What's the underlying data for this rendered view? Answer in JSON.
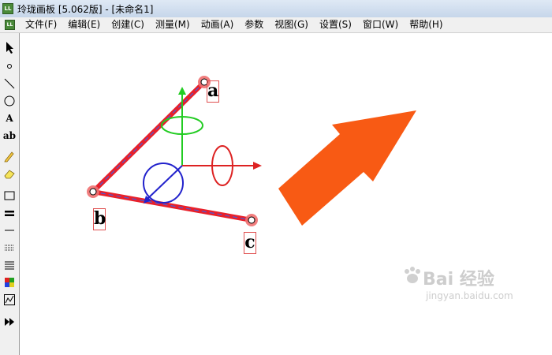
{
  "window": {
    "title": "玲珑画板 [5.062版] - [未命名1]"
  },
  "menu": {
    "items": [
      "文件(F)",
      "编辑(E)",
      "创建(C)",
      "测量(M)",
      "动画(A)",
      "参数",
      "视图(G)",
      "设置(S)",
      "窗口(W)",
      "帮助(H)"
    ]
  },
  "toolbar": {
    "text_tool_label": "A",
    "label_tool_label": "ab",
    "icons": [
      "pointer-icon",
      "point-icon",
      "line-icon",
      "circle-icon",
      "text-icon",
      "label-icon",
      "pen-icon",
      "eraser-icon",
      "rectangle-icon",
      "thick-line-icon",
      "thin-line-icon",
      "dotted-line-icon",
      "line-style-icon",
      "color-palette-icon",
      "graph-icon",
      "play-forward-icon"
    ]
  },
  "canvas": {
    "points": [
      {
        "label": "a"
      },
      {
        "label": "b"
      },
      {
        "label": "c"
      }
    ],
    "colors": {
      "segment": "#e8202a",
      "segment_dash": "#4a5ad8",
      "point_halo": "#f07070",
      "axis_green": "#22cc22",
      "axis_red": "#dd2222",
      "axis_blue": "#2222cc",
      "arrow": "#f85a14"
    }
  },
  "watermark": {
    "brand": "Bai 经验",
    "url": "jingyan.baidu.com"
  }
}
